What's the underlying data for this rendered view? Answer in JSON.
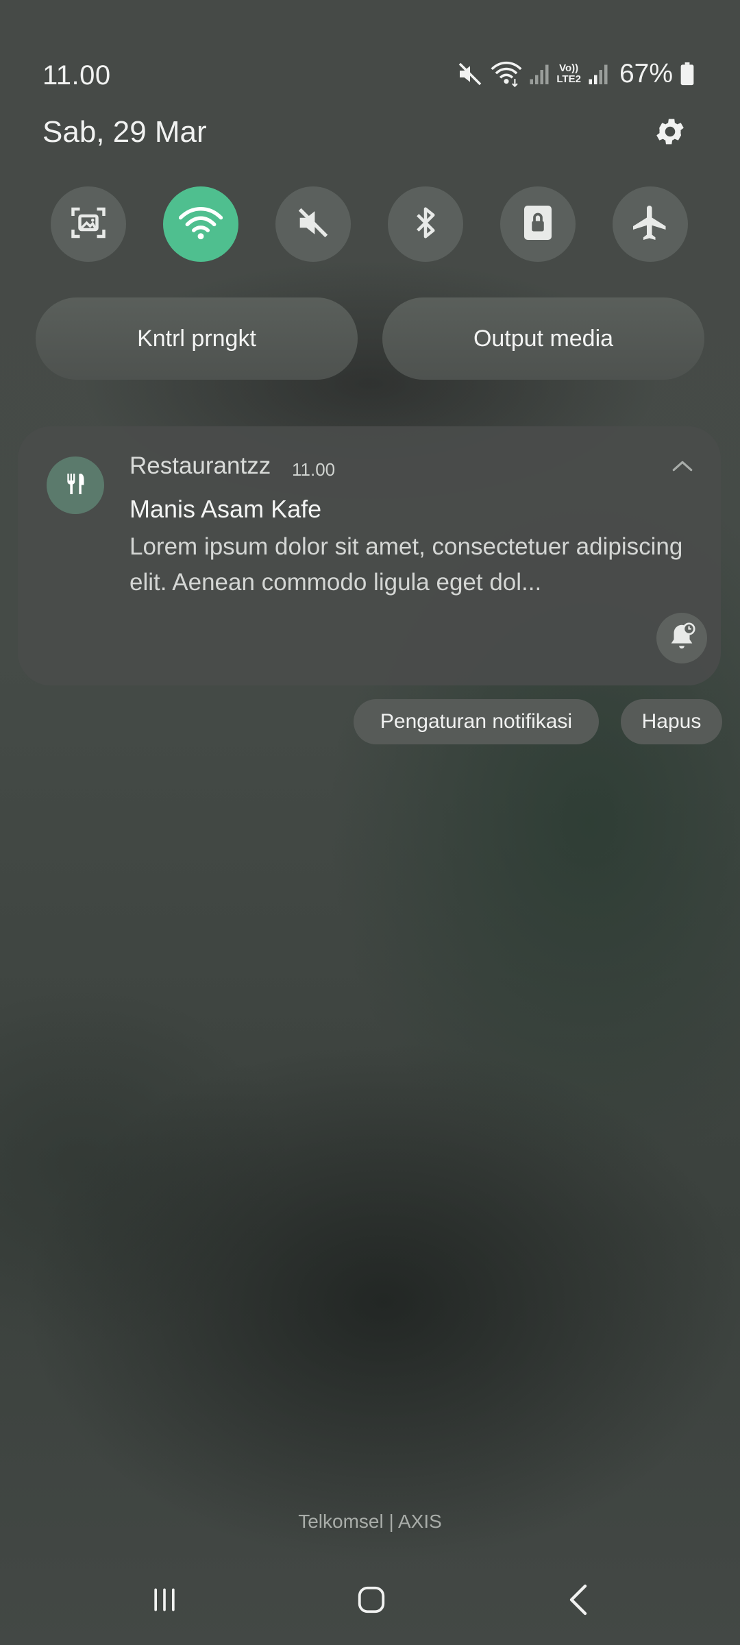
{
  "status_bar": {
    "time": "11.00",
    "battery_percent": "67%",
    "icons": [
      "mute-icon",
      "wifi-icon",
      "signal-icon",
      "volte-lte2-icon",
      "signal-icon",
      "battery-icon"
    ],
    "volte_label_top": "Vo))",
    "volte_label_bottom": "LTE2"
  },
  "header": {
    "date": "Sab, 29 Mar"
  },
  "quick_settings": {
    "toggles": [
      {
        "name": "screenshot-icon",
        "active": false
      },
      {
        "name": "wifi-icon",
        "active": true
      },
      {
        "name": "mute-icon",
        "active": false
      },
      {
        "name": "bluetooth-icon",
        "active": false
      },
      {
        "name": "rotation-lock-icon",
        "active": false
      },
      {
        "name": "airplane-icon",
        "active": false
      }
    ],
    "device_control_label": "Kntrl prngkt",
    "media_output_label": "Output media"
  },
  "notification": {
    "app_name": "Restaurantzz",
    "time": "11.00",
    "title": "Manis Asam Kafe",
    "body": "Lorem ipsum dolor sit amet, consectetuer adipiscing elit. Aenean commodo ligula eget dol..."
  },
  "actions": {
    "settings_label": "Pengaturan notifikasi",
    "clear_label": "Hapus"
  },
  "footer": {
    "carrier": "Telkomsel | AXIS"
  },
  "colors": {
    "accent_active": "#4fbf8f",
    "app_icon_bg": "#5b7a6c"
  }
}
